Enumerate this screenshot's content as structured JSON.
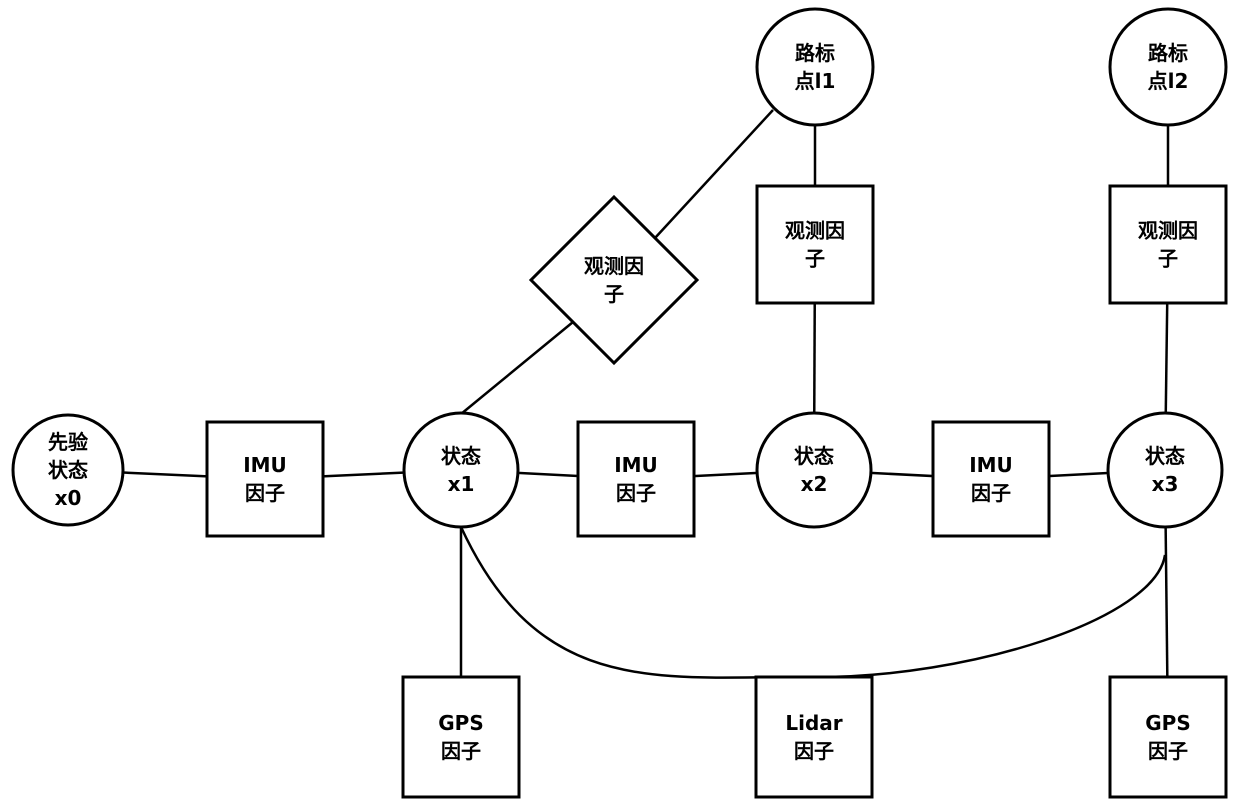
{
  "diagram": {
    "title": "",
    "colors": {
      "stroke": "#000000",
      "fill": "#ffffff",
      "text": "#000000"
    },
    "nodes": [
      {
        "id": "prior",
        "shape": "circle",
        "lines": [
          "先验",
          "状态",
          "x0"
        ]
      },
      {
        "id": "imu1",
        "shape": "rect",
        "lines": [
          "IMU",
          "因子"
        ]
      },
      {
        "id": "x1",
        "shape": "circle",
        "lines": [
          "状态",
          "x1"
        ]
      },
      {
        "id": "imu2",
        "shape": "rect",
        "lines": [
          "IMU",
          "因子"
        ]
      },
      {
        "id": "x2",
        "shape": "circle",
        "lines": [
          "状态",
          "x2"
        ]
      },
      {
        "id": "imu3",
        "shape": "rect",
        "lines": [
          "IMU",
          "因子"
        ]
      },
      {
        "id": "x3",
        "shape": "circle",
        "lines": [
          "状态",
          "x3"
        ]
      },
      {
        "id": "obs_diamond",
        "shape": "diamond",
        "lines": [
          "观测因",
          "子"
        ]
      },
      {
        "id": "lm11",
        "shape": "circle",
        "lines": [
          "路标",
          "点l1"
        ]
      },
      {
        "id": "obs2",
        "shape": "rect",
        "lines": [
          "观测因",
          "子"
        ]
      },
      {
        "id": "lm12",
        "shape": "circle",
        "lines": [
          "路标",
          "点l2"
        ]
      },
      {
        "id": "obs3",
        "shape": "rect",
        "lines": [
          "观测因",
          "子"
        ]
      },
      {
        "id": "gps1",
        "shape": "rect",
        "lines": [
          "GPS",
          "因子"
        ]
      },
      {
        "id": "lidar",
        "shape": "rect",
        "lines": [
          "Lidar",
          "因子"
        ]
      },
      {
        "id": "gps3",
        "shape": "rect",
        "lines": [
          "GPS",
          "因子"
        ]
      }
    ],
    "edges": [
      {
        "from": "prior",
        "to": "imu1"
      },
      {
        "from": "imu1",
        "to": "x1"
      },
      {
        "from": "x1",
        "to": "imu2"
      },
      {
        "from": "imu2",
        "to": "x2"
      },
      {
        "from": "x2",
        "to": "imu3"
      },
      {
        "from": "imu3",
        "to": "x3"
      },
      {
        "from": "x1",
        "to": "obs_diamond"
      },
      {
        "from": "obs_diamond",
        "to": "lm11"
      },
      {
        "from": "lm11",
        "to": "obs2"
      },
      {
        "from": "obs2",
        "to": "x2"
      },
      {
        "from": "lm12",
        "to": "obs3"
      },
      {
        "from": "obs3",
        "to": "x3"
      },
      {
        "from": "x1",
        "to": "gps1"
      },
      {
        "from": "x3",
        "to": "gps3"
      },
      {
        "from": "x1",
        "to": "x3",
        "via": "lidar",
        "style": "curve"
      }
    ]
  }
}
